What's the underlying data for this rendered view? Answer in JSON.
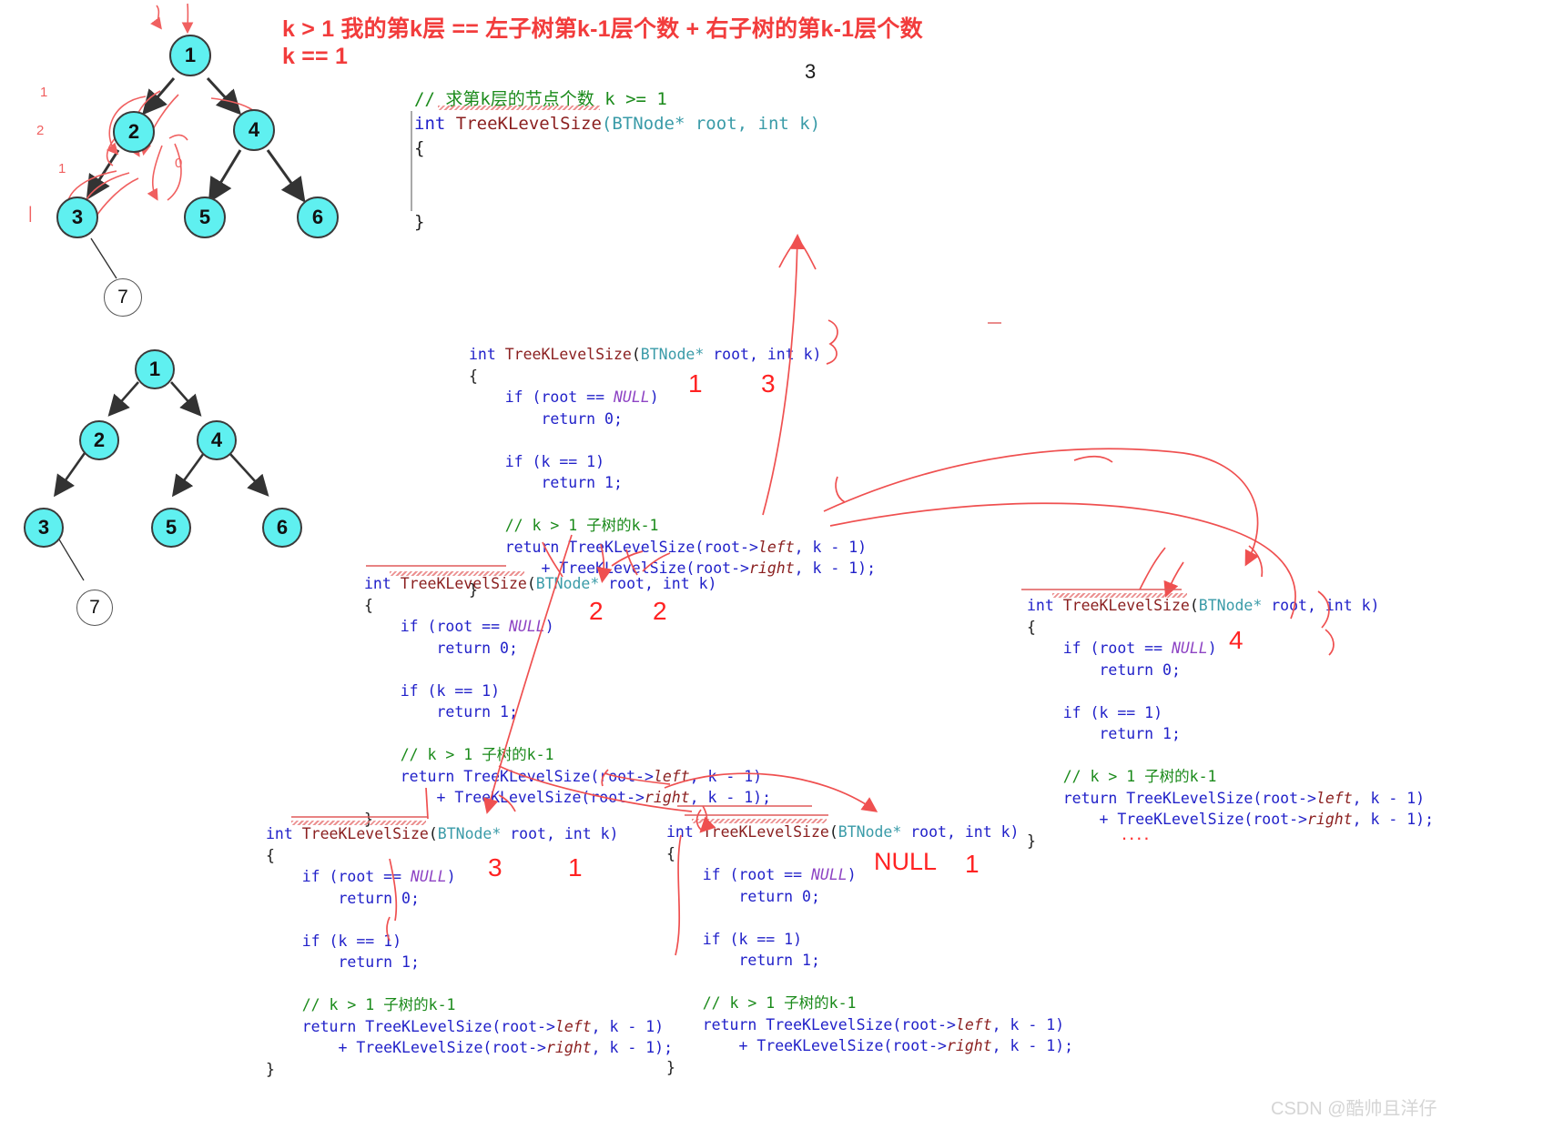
{
  "annotations": {
    "formula_line1": "k > 1 我的第k层 == 左子树第k-1层个数 + 右子树的第k-1层个数",
    "formula_line2": "k == 1",
    "top_three": "3",
    "mid_one": "1",
    "mid_three": "3",
    "blk2_two_a": "2",
    "blk2_two_b": "2",
    "blk3_three": "3",
    "blk3_one": "1",
    "blk4_null": "NULL",
    "blk4_one": "1",
    "blk5_four": "4",
    "dots": "....",
    "tree1_marks": [
      "1",
      "2",
      "1",
      "0"
    ]
  },
  "watermark": "CSDN @酷帅且洋仔",
  "top_code": {
    "comment": "// 求第k层的节点个数 k >= 1",
    "signature_pre": "int ",
    "signature_name": "TreeKLevelSize",
    "signature_args": "(BTNode* root, int k)",
    "open_brace": "{",
    "close_brace": "}"
  },
  "code_block": {
    "line_sig_kw": "int ",
    "line_sig_fn": "TreeKLevelSize",
    "line_sig_open": "(",
    "line_sig_type": "BTNode*",
    "line_sig_root": " root, ",
    "line_sig_intk": "int",
    "line_sig_k": " k)",
    "open_brace": "{",
    "if_null": "    if (root == ",
    "null_word": "NULL",
    "if_null_close": ")",
    "return_zero": "        return 0;",
    "if_k1": "    if (k == 1)",
    "return_one": "        return 1;",
    "comment_k": "    // k > 1 子树的k-1",
    "return_left_a": "    return TreeKLevelSize(root->",
    "left_word": "left",
    "return_left_b": ", k - 1)",
    "return_right_a": "        + TreeKLevelSize(root->",
    "right_word": "right",
    "return_right_b": ", k - 1);",
    "close_brace": "}"
  },
  "trees": {
    "tree1": {
      "nodes": [
        {
          "label": "1",
          "kind": "cyan"
        },
        {
          "label": "2",
          "kind": "cyan"
        },
        {
          "label": "4",
          "kind": "cyan"
        },
        {
          "label": "3",
          "kind": "cyan"
        },
        {
          "label": "5",
          "kind": "cyan"
        },
        {
          "label": "6",
          "kind": "cyan"
        },
        {
          "label": "7",
          "kind": "white"
        }
      ],
      "edges": [
        [
          "1",
          "2"
        ],
        [
          "1",
          "4"
        ],
        [
          "2",
          "3"
        ],
        [
          "4",
          "5"
        ],
        [
          "4",
          "6"
        ],
        [
          "3",
          "7"
        ]
      ]
    },
    "tree2": {
      "nodes": [
        {
          "label": "1",
          "kind": "cyan"
        },
        {
          "label": "2",
          "kind": "cyan"
        },
        {
          "label": "4",
          "kind": "cyan"
        },
        {
          "label": "3",
          "kind": "cyan"
        },
        {
          "label": "5",
          "kind": "cyan"
        },
        {
          "label": "6",
          "kind": "cyan"
        },
        {
          "label": "7",
          "kind": "white"
        }
      ],
      "edges": [
        [
          "1",
          "2"
        ],
        [
          "1",
          "4"
        ],
        [
          "2",
          "3"
        ],
        [
          "4",
          "5"
        ],
        [
          "4",
          "6"
        ],
        [
          "3",
          "7"
        ]
      ]
    }
  },
  "colors": {
    "node_fill": "#5ff0f0",
    "annotation_red": "#ff2222",
    "keyword_blue": "#2020c8",
    "function_maroon": "#8b2020",
    "comment_green": "#1a8a1a",
    "type_teal": "#3a9ba8"
  }
}
